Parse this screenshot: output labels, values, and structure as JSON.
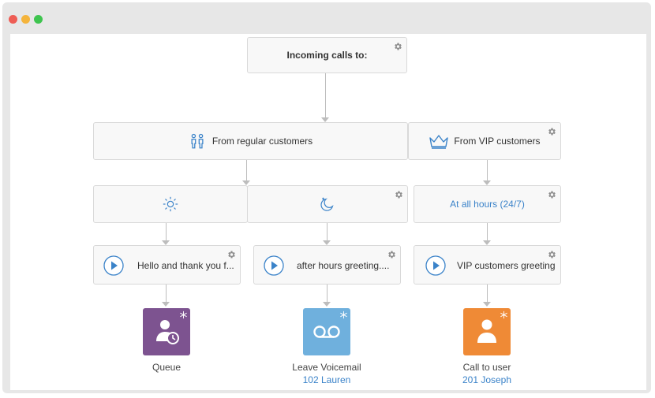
{
  "window": {
    "controls": [
      {
        "name": "close",
        "color": "#ee5d55"
      },
      {
        "name": "minimize",
        "color": "#f4b43c"
      },
      {
        "name": "maximize",
        "color": "#3ec44f"
      }
    ]
  },
  "flow": {
    "root": {
      "label": "Incoming calls to:"
    },
    "branches": {
      "regular": {
        "label": "From regular customers",
        "icon": "people-icon"
      },
      "vip": {
        "label": "From VIP customers",
        "icon": "crown-icon"
      }
    },
    "schedule": {
      "day": {
        "icon": "sun-icon"
      },
      "night": {
        "icon": "moon-icon"
      },
      "all_hours": {
        "label": "At all hours (24/7)"
      }
    },
    "greetings": [
      {
        "label": "Hello and thank you f...",
        "icon": "play-icon"
      },
      {
        "label": "after hours greeting....",
        "icon": "play-icon"
      },
      {
        "label": "VIP customers greeting",
        "icon": "play-icon"
      }
    ],
    "destinations": [
      {
        "label": "Queue",
        "sub": "",
        "icon": "queue-user-icon",
        "color": "#7d5390"
      },
      {
        "label": "Leave Voicemail",
        "sub": "102 Lauren",
        "icon": "voicemail-icon",
        "color": "#6fb0dd"
      },
      {
        "label": "Call to user",
        "sub": "201 Joseph",
        "icon": "user-icon",
        "color": "#ef8a36"
      }
    ]
  },
  "colors": {
    "accent": "#3b83c9",
    "gear": "#8c8c8c",
    "connector": "#bdbdbd"
  }
}
